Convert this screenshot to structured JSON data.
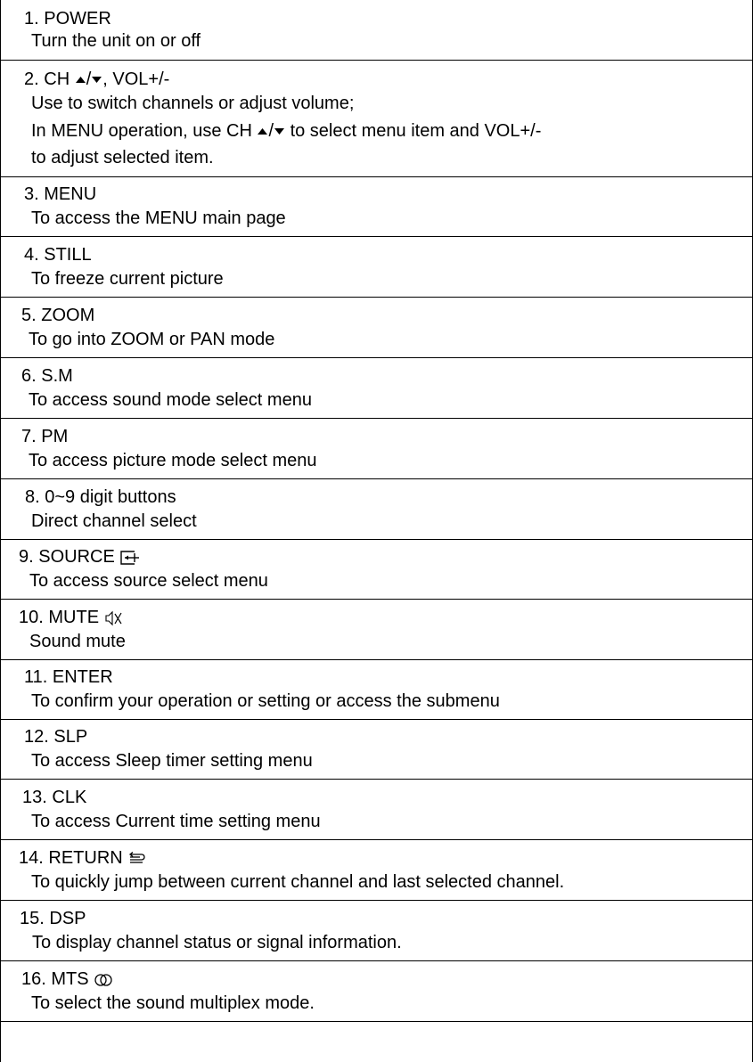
{
  "entries": [
    {
      "number": "1.",
      "title": "POWER",
      "desc": [
        "Turn the unit on or off"
      ]
    },
    {
      "number": "2.",
      "title_prefix": "CH",
      "title_sep": "/",
      "title_suffix": ", VOL+/-",
      "desc": [
        "Use to switch channels or adjust volume;"
      ],
      "desc2_prefix": "In MENU operation, use CH",
      "desc2_sep": "/",
      "desc2_suffix": " to select menu item and VOL+/-",
      "desc3": "to adjust selected item."
    },
    {
      "number": "3.",
      "title": "MENU",
      "desc": [
        "To access the MENU main page"
      ]
    },
    {
      "number": "4.",
      "title": "STILL",
      "desc": [
        "To freeze current picture"
      ]
    },
    {
      "number": "5.",
      "title": "ZOOM",
      "desc": [
        "To go into ZOOM or PAN mode"
      ]
    },
    {
      "number": "6.",
      "title": "S.M",
      "desc": [
        "To access sound mode select menu"
      ]
    },
    {
      "number": "7.",
      "title": "PM",
      "desc": [
        "To access picture mode select menu"
      ]
    },
    {
      "number": "8.",
      "title": "0~9 digit buttons",
      "desc": [
        "Direct channel select"
      ]
    },
    {
      "number": "9.",
      "title": "SOURCE",
      "icon": "input-source-icon",
      "desc": [
        "To access source select menu"
      ]
    },
    {
      "number": "10.",
      "title": "MUTE",
      "icon": "mute-icon",
      "desc": [
        "Sound mute"
      ]
    },
    {
      "number": "11.",
      "title": "ENTER",
      "desc": [
        "To confirm your operation or setting or access the submenu"
      ]
    },
    {
      "number": "12.",
      "title": "SLP",
      "desc": [
        "To access Sleep timer setting menu"
      ]
    },
    {
      "number": "13.",
      "title": "CLK",
      "desc": [
        "To access Current time setting menu"
      ]
    },
    {
      "number": "14.",
      "title": "RETURN",
      "icon": "return-icon",
      "desc": [
        "To quickly jump between current channel and last selected channel."
      ]
    },
    {
      "number": "15.",
      "title": "DSP",
      "desc": [
        "To display channel status or signal information."
      ]
    },
    {
      "number": "16.",
      "title": "MTS",
      "icon": "stereo-icon",
      "desc": [
        "To select the sound multiplex mode."
      ]
    }
  ]
}
